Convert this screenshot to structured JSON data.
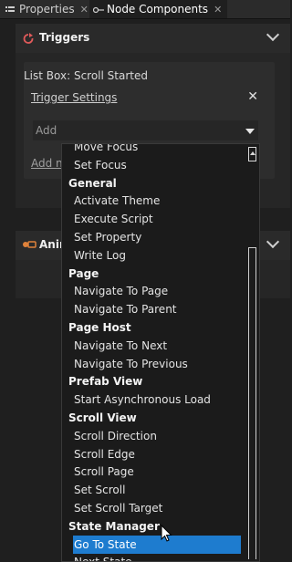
{
  "tabs": [
    {
      "label": "Properties",
      "icon": "properties-icon",
      "close": "✕"
    },
    {
      "label": "Node Components",
      "icon": "node-components-icon",
      "close": "✕"
    }
  ],
  "triggers": {
    "title": "Triggers",
    "label": "List Box: Scroll Started",
    "link": "Trigger Settings",
    "remove": "✕",
    "add_placeholder": "Add",
    "add_new": "Add ne"
  },
  "animations": {
    "title": "Anim"
  },
  "dropdown": {
    "items": [
      {
        "type": "opt",
        "label": "Move Focus"
      },
      {
        "type": "opt",
        "label": "Set Focus"
      },
      {
        "type": "hdr",
        "label": "General"
      },
      {
        "type": "opt",
        "label": "Activate Theme"
      },
      {
        "type": "opt",
        "label": "Execute Script"
      },
      {
        "type": "opt",
        "label": "Set Property"
      },
      {
        "type": "opt",
        "label": "Write Log"
      },
      {
        "type": "hdr",
        "label": "Page"
      },
      {
        "type": "opt",
        "label": "Navigate To Page"
      },
      {
        "type": "opt",
        "label": "Navigate To Parent"
      },
      {
        "type": "hdr",
        "label": "Page Host"
      },
      {
        "type": "opt",
        "label": "Navigate To Next"
      },
      {
        "type": "opt",
        "label": "Navigate To Previous"
      },
      {
        "type": "hdr",
        "label": "Prefab View"
      },
      {
        "type": "opt",
        "label": "Start Asynchronous Load"
      },
      {
        "type": "hdr",
        "label": "Scroll View"
      },
      {
        "type": "opt",
        "label": "Scroll Direction"
      },
      {
        "type": "opt",
        "label": "Scroll Edge"
      },
      {
        "type": "opt",
        "label": "Scroll Page"
      },
      {
        "type": "opt",
        "label": "Set Scroll"
      },
      {
        "type": "opt",
        "label": "Set Scroll Target"
      },
      {
        "type": "hdr",
        "label": "State Manager"
      },
      {
        "type": "sel",
        "label": "Go To State"
      },
      {
        "type": "opt",
        "label": "Next State"
      }
    ]
  }
}
